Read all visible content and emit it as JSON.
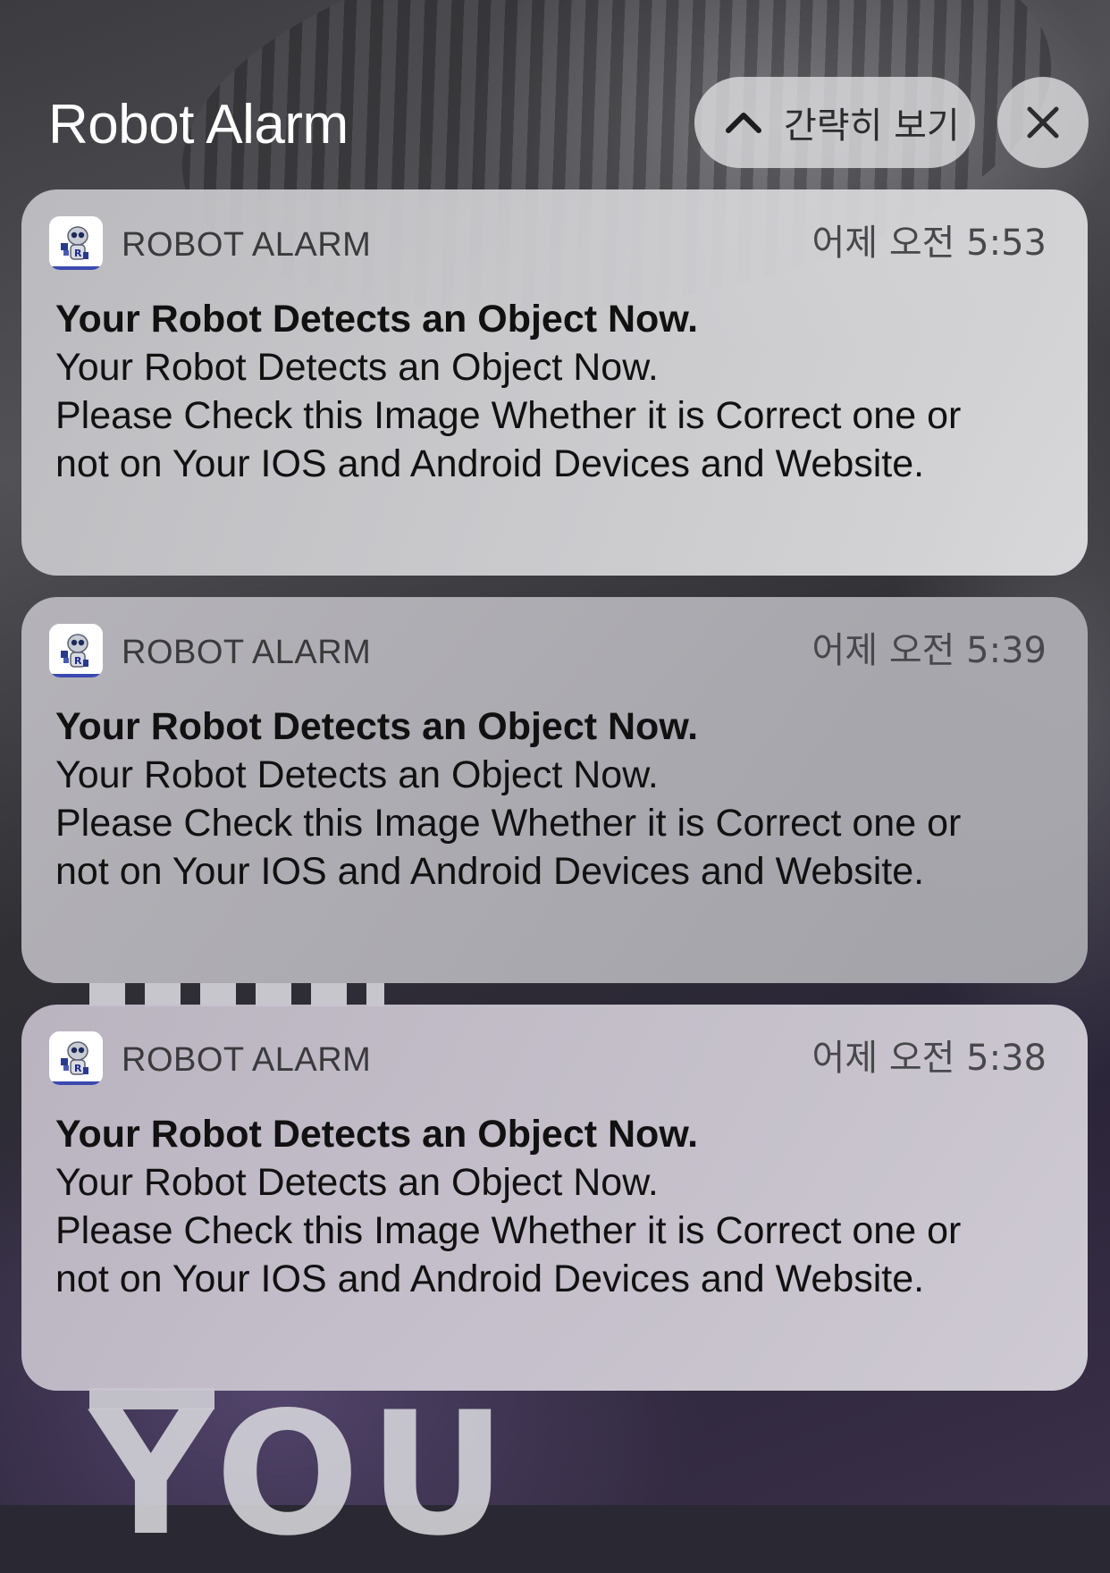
{
  "header": {
    "group_title": "Robot Alarm",
    "show_less_label": "간략히 보기",
    "show_less_icon": "chevron-up-icon",
    "close_icon": "close-icon"
  },
  "notifications": [
    {
      "app_name": "ROBOT ALARM",
      "app_icon": "robot-app-icon",
      "time": "어제 오전 5:53",
      "title": "Your Robot Detects an Object Now.",
      "body_lines": [
        "Your Robot Detects an Object Now.",
        "Please Check this Image Whether it is Correct one or",
        "not on Your IOS and Android Devices and Website."
      ]
    },
    {
      "app_name": "ROBOT ALARM",
      "app_icon": "robot-app-icon",
      "time": "어제 오전 5:39",
      "title": "Your Robot Detects an Object Now.",
      "body_lines": [
        "Your Robot Detects an Object Now.",
        "Please Check this Image Whether it is Correct one or",
        "not on Your IOS and Android Devices and Website."
      ]
    },
    {
      "app_name": "ROBOT ALARM",
      "app_icon": "robot-app-icon",
      "time": "어제 오전 5:38",
      "title": "Your Robot Detects an Object Now.",
      "body_lines": [
        "Your Robot Detects an Object Now.",
        "Please Check this Image Whether it is Correct one or",
        "not on Your IOS and Android Devices and Website."
      ]
    }
  ],
  "wallpaper": {
    "text": "YOU"
  }
}
